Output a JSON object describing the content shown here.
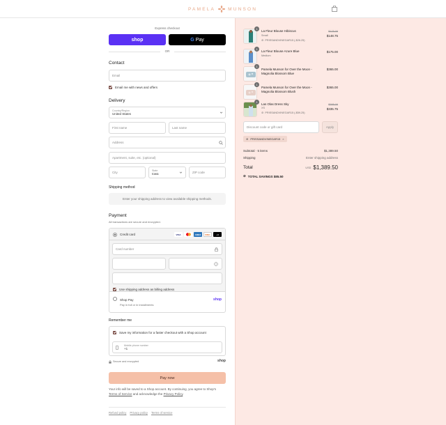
{
  "brand": {
    "logo_text": "PAMELA  MUNSON",
    "accent": "#e8a98a"
  },
  "express": {
    "label": "Express checkout",
    "shop_label": "shop",
    "gpay_label": "Pay",
    "or": "OR"
  },
  "contact": {
    "heading": "Contact",
    "email_placeholder": "Email",
    "news_label": "Email me with news and offers"
  },
  "delivery": {
    "heading": "Delivery",
    "country_label": "Country/Region",
    "country_value": "United States",
    "first_name": "First name",
    "last_name": "Last name",
    "address": "Address",
    "apartment": "Apartment, suite, etc. (optional)",
    "city": "City",
    "state_label": "State",
    "state_value": "Iowa",
    "zip": "ZIP code"
  },
  "shipping": {
    "heading": "Shipping method",
    "message": "Enter your shipping address to view available shipping methods."
  },
  "payment": {
    "heading": "Payment",
    "subheading": "All transactions are secure and encrypted.",
    "credit_card": "Credit card",
    "card_logos": [
      "VISA",
      "MC",
      "AMEX",
      "DISC",
      "+4"
    ],
    "card_number": "Card number",
    "billing_same": "Use shipping address as billing address",
    "shop_pay_title": "Shop Pay",
    "shop_pay_sub": "Pay in full or in installments",
    "shop_pay_logo": "shop"
  },
  "remember": {
    "heading": "Remember me",
    "save_label": "Save my information for a faster checkout with a Shop account",
    "phone_label": "Mobile phone number",
    "phone_value": "+1",
    "secure": "Secure and encrypted",
    "shop_logo": "shop"
  },
  "pay_now": "Pay now",
  "fine_print": {
    "line1": "Your info will be saved to a Shop account. By continuing, you agree to Shop's",
    "tos": "Terms of Service",
    "and": " and acknowledge the ",
    "privacy": "Privacy Policy",
    "end": "."
  },
  "footer": [
    "Refund policy",
    "Privacy policy",
    "Terms of service"
  ],
  "cart": {
    "items": [
      {
        "name": "La Fleur Blouse Hibiscus",
        "variant": "Small",
        "discount": "PRISSANDVINEGAR15 (-$26.25)",
        "orig": "$175.00",
        "price": "$148.75",
        "qty": "1"
      },
      {
        "name": "La Fleur Blouse Azure Blue",
        "variant": "Medium",
        "discount": "",
        "orig": "",
        "price": "$175.00",
        "qty": "1"
      },
      {
        "name": "Pamela Munson for Over the Moon - Magnolia Blossom Blue",
        "variant": "",
        "discount": "",
        "orig": "",
        "price": "$365.00",
        "qty": "1"
      },
      {
        "name": "Pamela Munson for Over the Moon - Magnolia Blossom Blush",
        "variant": "",
        "discount": "",
        "orig": "",
        "price": "$365.00",
        "qty": "1"
      },
      {
        "name": "Las Olas Dress Sky",
        "variant": "XS",
        "discount": "PRISSANDVINEGAR15 (-$59.25)",
        "orig": "$395.00",
        "price": "$335.75",
        "qty": "1"
      }
    ],
    "discount_placeholder": "Discount code or gift card",
    "apply": "Apply",
    "applied_code": "PRISSANDVINEGAR15",
    "subtotal_label": "Subtotal · 5 items",
    "subtotal_value": "$1,389.50",
    "shipping_label": "Shipping",
    "shipping_value": "Enter shipping address",
    "total_label": "Total",
    "currency": "USD",
    "total_value": "$1,389.50",
    "savings": "TOTAL SAVINGS  $85.50"
  }
}
